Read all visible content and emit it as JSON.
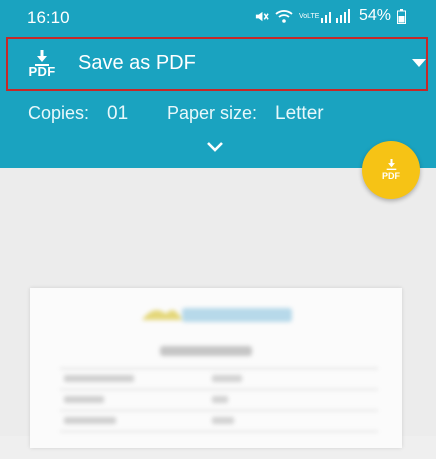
{
  "status_bar": {
    "time": "16:10",
    "network_label": "VoLTE",
    "battery": "54%"
  },
  "header": {
    "printer_icon": "pdf-download-icon",
    "printer_icon_label": "PDF",
    "printer_name": "Save as PDF",
    "copies_label": "Copies:",
    "copies_value": "01",
    "paper_size_label": "Paper size:",
    "paper_size_value": "Letter"
  },
  "fab": {
    "icon": "pdf-download-icon",
    "label": "PDF"
  },
  "colors": {
    "header": "#1aa3c0",
    "fab": "#f6c315",
    "highlight_border": "#c62828"
  }
}
